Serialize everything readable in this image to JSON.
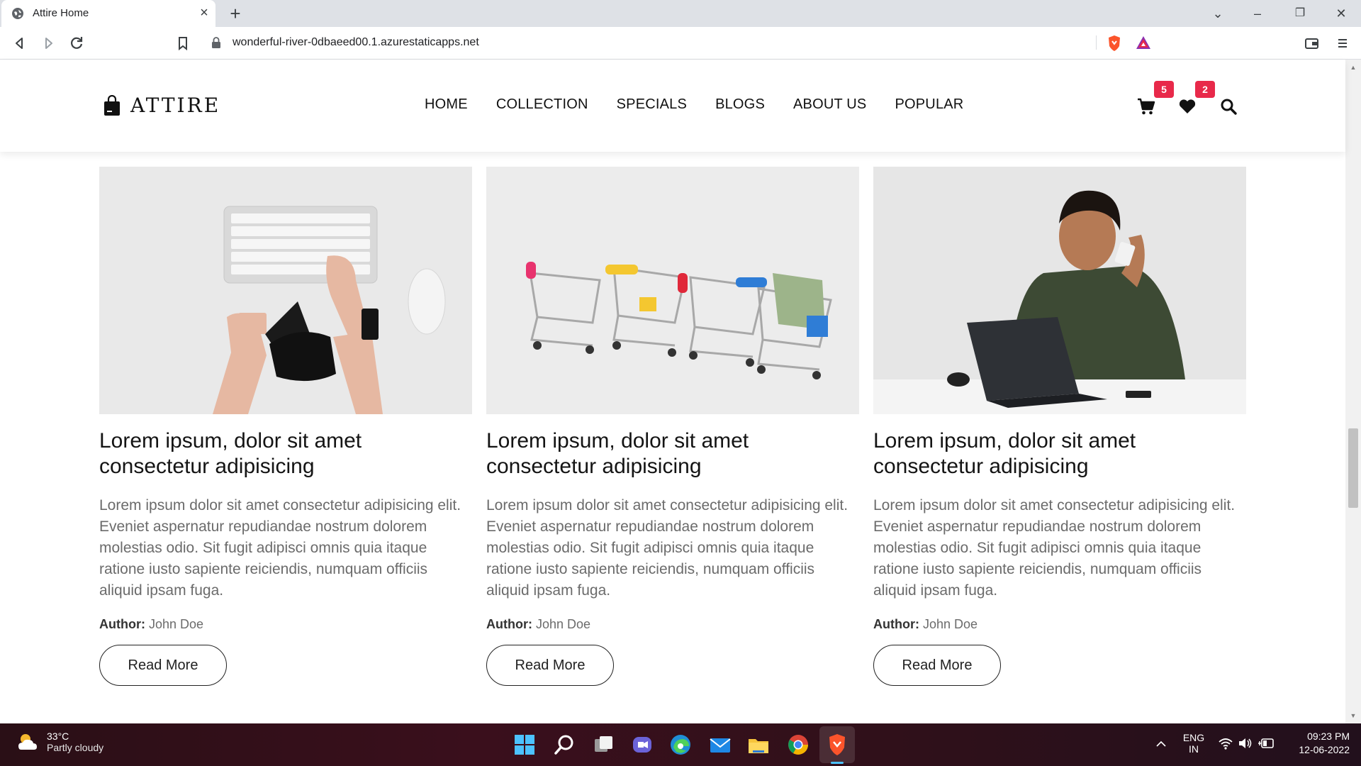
{
  "browser": {
    "tab_title": "Attire Home",
    "tab_close": "×",
    "new_tab": "+",
    "url": "wonderful-river-0dbaeed00.1.azurestaticapps.net",
    "window_controls": {
      "minimize": "–",
      "maximize": "❐",
      "close": "✕",
      "tab_search": "⌄"
    }
  },
  "site": {
    "logo_text": "ATTIRE",
    "nav": [
      "HOME",
      "COLLECTION",
      "SPECIALS",
      "BLOGS",
      "ABOUT US",
      "POPULAR"
    ],
    "cart_count": "5",
    "wishlist_count": "2"
  },
  "cards": [
    {
      "title": "Lorem ipsum, dolor sit amet consectetur adipisicing",
      "body": "Lorem ipsum dolor sit amet consectetur adipisicing elit. Eveniet aspernatur repudiandae nostrum dolorem molestias odio. Sit fugit adipisci omnis quia itaque ratione iusto sapiente reiciendis, numquam officiis aliquid ipsam fuga.",
      "author_label": "Author:",
      "author": "John Doe",
      "button": "Read More",
      "image": "keyboard-and-wallet-photo"
    },
    {
      "title": "Lorem ipsum, dolor sit amet consectetur adipisicing",
      "body": "Lorem ipsum dolor sit amet consectetur adipisicing elit. Eveniet aspernatur repudiandae nostrum dolorem molestias odio. Sit fugit adipisci omnis quia itaque ratione iusto sapiente reiciendis, numquam officiis aliquid ipsam fuga.",
      "author_label": "Author:",
      "author": "John Doe",
      "button": "Read More",
      "image": "shopping-carts-photo"
    },
    {
      "title": "Lorem ipsum, dolor sit amet consectetur adipisicing",
      "body": "Lorem ipsum dolor sit amet consectetur adipisicing elit. Eveniet aspernatur repudiandae nostrum dolorem molestias odio. Sit fugit adipisci omnis quia itaque ratione iusto sapiente reiciendis, numquam officiis aliquid ipsam fuga.",
      "author_label": "Author:",
      "author": "John Doe",
      "button": "Read More",
      "image": "man-with-laptop-photo"
    }
  ],
  "taskbar": {
    "temperature": "33°C",
    "weather": "Partly cloudy",
    "lang_top": "ENG",
    "lang_bottom": "IN",
    "time": "09:23 PM",
    "date": "12-06-2022"
  },
  "colors": {
    "badge": "#e8294a",
    "text_dark": "#141414",
    "text_muted": "#6b6b6b",
    "brave_orange": "#fb542b"
  }
}
